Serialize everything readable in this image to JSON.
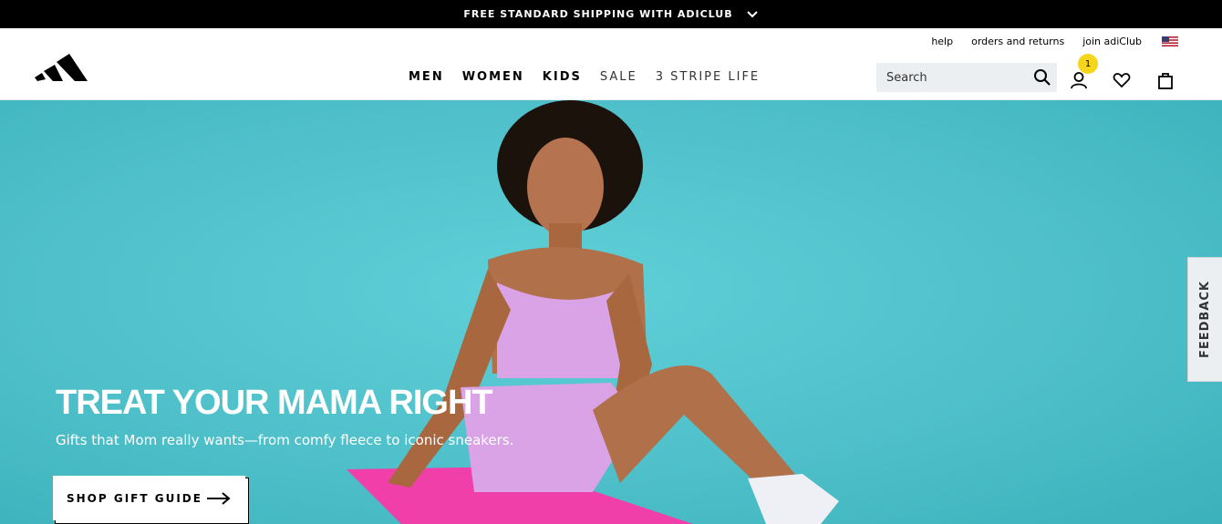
{
  "promo": {
    "text": "FREE STANDARD SHIPPING WITH ADICLUB"
  },
  "util_links": [
    "help",
    "orders and returns",
    "join adiClub"
  ],
  "nav": [
    "MEN",
    "WOMEN",
    "KIDS",
    "SALE",
    "3 STRIPE LIFE"
  ],
  "search": {
    "placeholder": "Search"
  },
  "account": {
    "badge": "1"
  },
  "hero": {
    "title": "TREAT YOUR MAMA RIGHT",
    "subtitle": "Gifts that Mom really wants—from comfy fleece to iconic sneakers.",
    "cta": "SHOP GIFT GUIDE"
  },
  "feedback": {
    "label": "FEEDBACK"
  },
  "colors": {
    "promo_bg": "#000000",
    "hero_bg": "#4fc0c9",
    "badge": "#f5d61b",
    "search_bg": "#eceff1"
  },
  "icons": {
    "logo": "adidas-performance-logo",
    "search": "search-icon",
    "account": "user-icon",
    "wishlist": "heart-icon",
    "bag": "shopping-bag-icon",
    "flag": "us-flag-icon"
  }
}
